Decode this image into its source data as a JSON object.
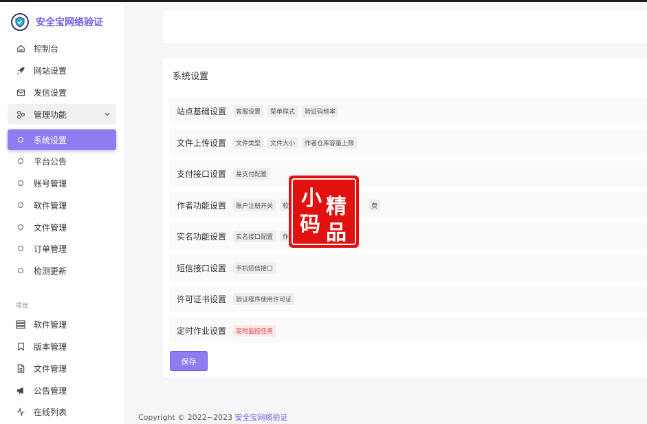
{
  "brand": {
    "title": "安全宝网络验证"
  },
  "sidebar": {
    "items": [
      {
        "label": "控制台",
        "icon": "home-icon"
      },
      {
        "label": "网站设置",
        "icon": "rocket-icon"
      },
      {
        "label": "发信设置",
        "icon": "mail-icon"
      },
      {
        "label": "管理功能",
        "icon": "modules-icon"
      }
    ],
    "sub_items": [
      {
        "label": "系统设置",
        "active": true
      },
      {
        "label": "平台公告"
      },
      {
        "label": "账号管理"
      },
      {
        "label": "软件管理"
      },
      {
        "label": "文件管理"
      },
      {
        "label": "订单管理"
      },
      {
        "label": "检测更新"
      }
    ],
    "section_label": "项目",
    "project_items": [
      {
        "label": "软件管理",
        "icon": "server-icon"
      },
      {
        "label": "版本管理",
        "icon": "bookmark-icon"
      },
      {
        "label": "文件管理",
        "icon": "file-icon"
      },
      {
        "label": "公告管理",
        "icon": "megaphone-icon"
      },
      {
        "label": "在线列表",
        "icon": "pulse-icon"
      }
    ]
  },
  "main": {
    "title": "系统设置",
    "rows": [
      {
        "label": "站点基础设置",
        "tags": [
          "客服设置",
          "菜单样式",
          "验证码频率"
        ]
      },
      {
        "label": "文件上传设置",
        "tags": [
          "文件类型",
          "文件大小",
          "作者仓库容量上限"
        ]
      },
      {
        "label": "支付接口设置",
        "tags": [
          "易支付配置"
        ]
      },
      {
        "label": "作者功能设置",
        "tags": [
          "账户注册开关",
          "软",
          "费"
        ]
      },
      {
        "label": "实名功能设置",
        "tags": [
          "实名接口配置",
          "作"
        ]
      },
      {
        "label": "短信接口设置",
        "tags": [
          "手机短信接口"
        ]
      },
      {
        "label": "许可证书设置",
        "tags": [
          "验证程序使用许可证"
        ]
      },
      {
        "label": "定时作业设置",
        "tags": [
          "定时监控任务"
        ],
        "tag_color": "red"
      }
    ],
    "save_label": "保存"
  },
  "stamp": {
    "chars": [
      "小",
      "精",
      "码",
      "品"
    ]
  },
  "footer": {
    "copyright": "Copyright © 2022~2023",
    "link": "安全宝网络验证"
  },
  "colors": {
    "accent": "#8e7cf0",
    "brand": "#6c5ce7",
    "stamp": "#e0110e",
    "danger": "#e23c3c"
  }
}
